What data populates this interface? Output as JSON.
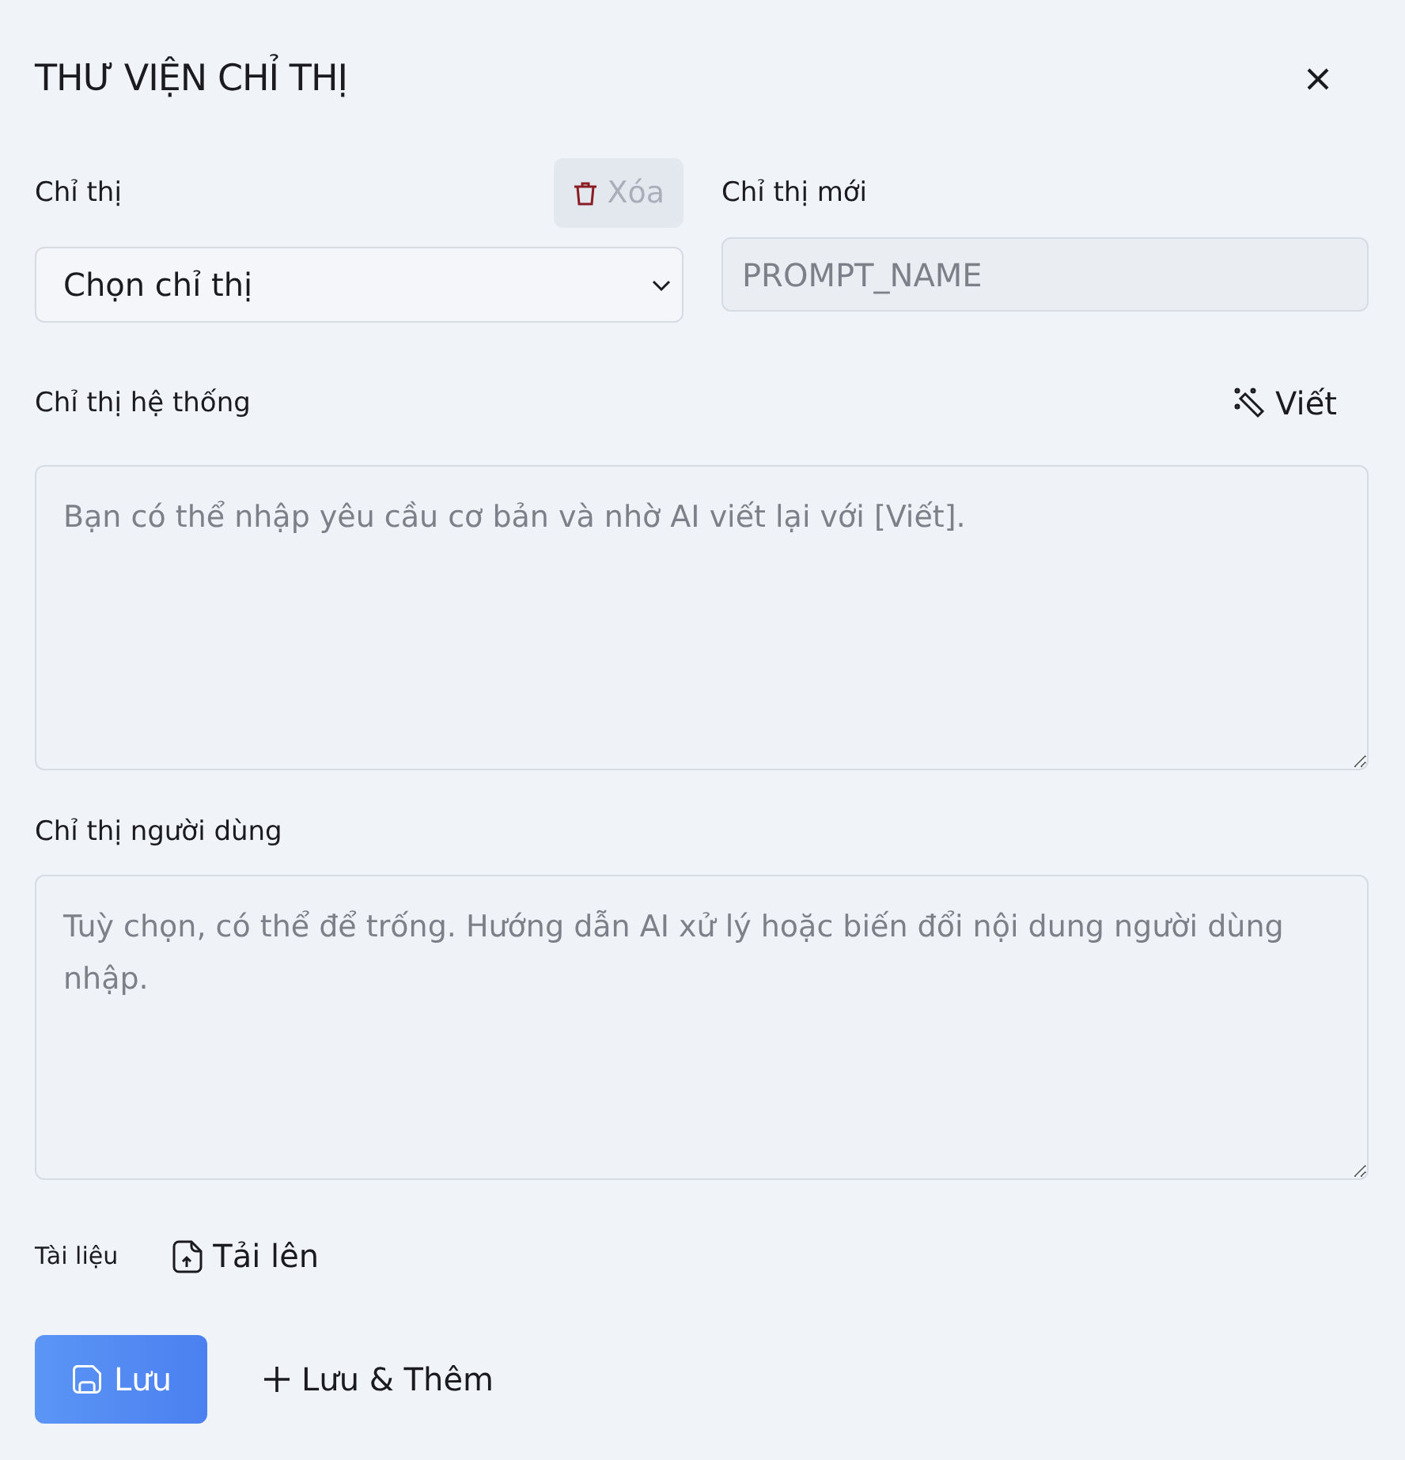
{
  "dialog": {
    "title": "THƯ VIỆN CHỈ THỊ"
  },
  "prompt_select": {
    "label": "Chỉ thị",
    "value": "Chọn chỉ thị"
  },
  "delete_button": {
    "label": "Xóa",
    "disabled": true
  },
  "new_prompt": {
    "label": "Chỉ thị mới",
    "placeholder": "PROMPT_NAME"
  },
  "system_prompt": {
    "label": "Chỉ thị hệ thống",
    "write_button": "Viết",
    "placeholder": "Bạn có thể nhập yêu cầu cơ bản và nhờ AI viết lại với [Viết]."
  },
  "user_prompt": {
    "label": "Chỉ thị người dùng",
    "placeholder": "Tuỳ chọn, có thể để trống. Hướng dẫn AI xử lý hoặc biến đổi nội dung người dùng nhập."
  },
  "documents": {
    "label": "Tài liệu",
    "upload_button": "Tải lên"
  },
  "buttons": [
    {
      "kind": "primary",
      "label": "Lưu"
    },
    {
      "kind": "secondary",
      "label": "Lưu & Thêm"
    }
  ]
}
